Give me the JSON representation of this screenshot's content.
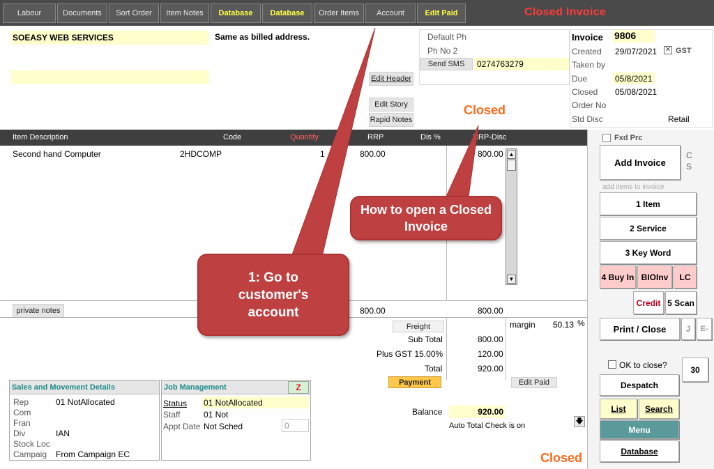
{
  "tabs": [
    {
      "label": "Labour"
    },
    {
      "label": "Documents"
    },
    {
      "label": "Sort Order"
    },
    {
      "label": "Item Notes"
    },
    {
      "label": "Database"
    },
    {
      "label": "Database"
    },
    {
      "label": "Order Items"
    },
    {
      "label": "Account"
    },
    {
      "label": "Edit Paid"
    }
  ],
  "window_status": "Closed  Invoice",
  "customer": {
    "name": "SOEASY WEB SERVICES",
    "delivery": "Same as billed address."
  },
  "phones": {
    "default_ph_label": "Default Ph",
    "ph_no2_label": "Ph No 2",
    "send_sms_label": "Send SMS",
    "sms_value": "0274763279"
  },
  "buttons": {
    "edit_header": "Edit Header",
    "edit_story": "Edit Story",
    "rapid_notes": "Rapid Notes",
    "private_notes": "private notes",
    "freight": "Freight",
    "payment": "Payment",
    "edit_paid": "Edit Paid"
  },
  "invoice": {
    "label": "Invoice",
    "number": "9806",
    "created_label": "Created",
    "created": "29/07/2021",
    "gst_label": "GST",
    "taken_by_label": "Taken by",
    "due_label": "Due",
    "due": "05/8/2021",
    "closed_label": "Closed",
    "closed": "05/08/2021",
    "order_no_label": "Order No",
    "std_disc_label": "Std Disc",
    "std_disc": "Retail"
  },
  "status_closed": "Closed",
  "columns": {
    "desc": "Item Description",
    "code": "Code",
    "qty": "Quantity",
    "rrp": "RRP",
    "dis": "Dis %",
    "rrp_disc": "RRP-Disc"
  },
  "items": [
    {
      "desc": "Second hand Computer",
      "code": "2HDCOMP",
      "qty": "1",
      "rrp": "800.00",
      "rrp_disc": "800.00"
    }
  ],
  "totals": {
    "rrp_total": "800.00",
    "disc_total": "800.00",
    "margin_label": "margin",
    "margin": "50.13",
    "margin_pct": "%",
    "subtotal_label": "Sub Total",
    "subtotal": "800.00",
    "gst_label": "Plus GST 15.00%",
    "gst": "120.00",
    "total_label": "Total",
    "total": "920.00",
    "balance_label": "Balance",
    "balance": "920.00",
    "auto_check": "Auto Total Check is on"
  },
  "sales_panel": {
    "title": "Sales and Movement Details",
    "rows": [
      {
        "label": "Rep",
        "value": "01 NotAllocated"
      },
      {
        "label": "Com",
        "value": ""
      },
      {
        "label": "Fran",
        "value": ""
      },
      {
        "label": "Div",
        "value": "IAN"
      },
      {
        "label": "Stock Loc",
        "value": ""
      },
      {
        "label": "Campaig",
        "value": "From Campaign EC"
      }
    ]
  },
  "job_panel": {
    "title": "Job Management",
    "z_label": "Z",
    "status_label": "Status",
    "status": "01 NotAllocated",
    "staff_label": "Staff",
    "staff": "01 Not",
    "appt_label": "Appt Date",
    "appt": "Not Sched",
    "appt_count": "0"
  },
  "right": {
    "fxd_prc": "Fxd Prc",
    "add_invoice": "Add Invoice",
    "cs": "C S",
    "hint": "add items to invoice",
    "item": "1 Item",
    "service": "2 Service",
    "keyword": "3 Key Word",
    "buyin": "4 Buy In",
    "bioinv": "BIOInv",
    "lc": "LC",
    "credit": "Credit",
    "scan": "5 Scan",
    "print_close": "Print / Close",
    "j": "J",
    "e": "E-",
    "ok_to_close": "OK to close?",
    "count": "30",
    "despatch": "Despatch",
    "list": "List",
    "search": "Search",
    "menu": "Menu",
    "database": "Database"
  },
  "callouts": {
    "open_closed": "How to open a Closed Invoice",
    "go_account": "1: Go to customer's account"
  },
  "colors": {
    "callout": "#bf4040",
    "closed_orange": "#ff6a1a",
    "status_red": "#ff3a3a",
    "highlight": "#ffffcc",
    "tab_bar": "#4a4a4a"
  }
}
